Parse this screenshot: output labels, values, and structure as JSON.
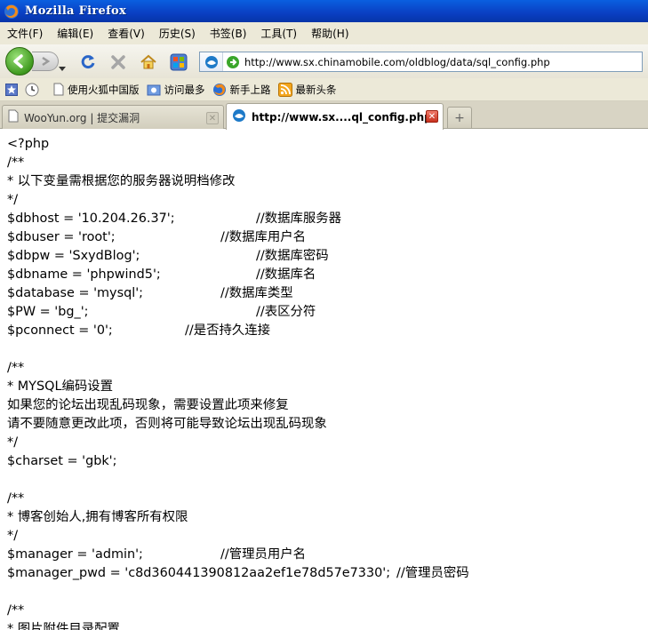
{
  "window": {
    "title": "Mozilla Firefox"
  },
  "menu": [
    "文件(F)",
    "编辑(E)",
    "查看(V)",
    "历史(S)",
    "书签(B)",
    "工具(T)",
    "帮助(H)"
  ],
  "nav": {
    "url": "http://www.sx.chinamobile.com/oldblog/data/sql_config.php"
  },
  "bookmarks": [
    "使用火狐中国版",
    "访问最多",
    "新手上路",
    "最新头条"
  ],
  "tabs": [
    {
      "label": "WooYun.org | 提交漏洞",
      "active": false
    },
    {
      "label": "http://www.sx....ql_config.php",
      "active": true
    }
  ],
  "content": {
    "lines": [
      {
        "code": "<?php",
        "comment": ""
      },
      {
        "code": "/**",
        "comment": ""
      },
      {
        "code": "* 以下变量需根据您的服务器说明档修改",
        "comment": ""
      },
      {
        "code": "*/",
        "comment": ""
      },
      {
        "code": "$dbhost = '10.204.26.37';",
        "comment": "//数据库服务器"
      },
      {
        "code": "$dbuser = 'root';",
        "comment": "//数据库用户名"
      },
      {
        "code": "$dbpw = 'SxydBlog';",
        "comment": "//数据库密码"
      },
      {
        "code": "$dbname = 'phpwind5';",
        "comment": "//数据库名"
      },
      {
        "code": "$database = 'mysql';",
        "comment": "//数据库类型"
      },
      {
        "code": "$PW = 'bg_';",
        "comment": "//表区分符"
      },
      {
        "code": "$pconnect = '0';",
        "comment": "//是否持久连接"
      },
      {
        "code": "",
        "comment": ""
      },
      {
        "code": "/**",
        "comment": ""
      },
      {
        "code": "* MYSQL编码设置",
        "comment": ""
      },
      {
        "code": "如果您的论坛出现乱码现象，需要设置此项来修复",
        "comment": ""
      },
      {
        "code": "请不要随意更改此项，否则将可能导致论坛出现乱码现象",
        "comment": ""
      },
      {
        "code": "*/",
        "comment": ""
      },
      {
        "code": "$charset = 'gbk';",
        "comment": ""
      },
      {
        "code": "",
        "comment": ""
      },
      {
        "code": "/**",
        "comment": ""
      },
      {
        "code": "* 博客创始人,拥有博客所有权限",
        "comment": ""
      },
      {
        "code": "*/",
        "comment": ""
      },
      {
        "code": "$manager = 'admin';",
        "comment": "//管理员用户名"
      },
      {
        "code": "$manager_pwd = 'c8d360441390812aa2ef1e78d57e7330';",
        "comment": "//管理员密码"
      },
      {
        "code": "",
        "comment": ""
      },
      {
        "code": "/**",
        "comment": ""
      },
      {
        "code": "* 图片附件目录配置",
        "comment": ""
      }
    ]
  }
}
